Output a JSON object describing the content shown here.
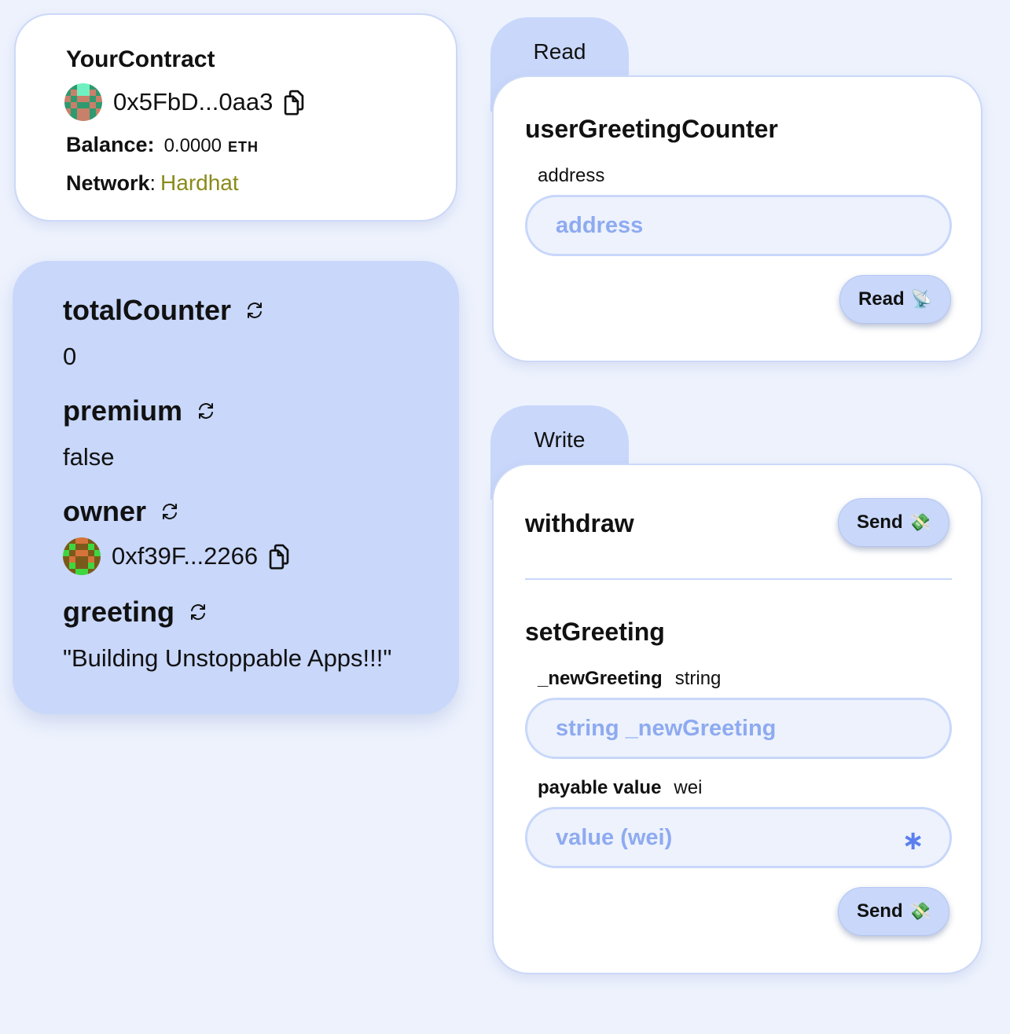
{
  "contract": {
    "name": "YourContract",
    "address": "0x5FbD...0aa3",
    "balance_label": "Balance:",
    "balance_value": "0.0000",
    "balance_unit": "ETH",
    "network_label": "Network",
    "network_sep": ":",
    "network_value": "Hardhat",
    "network_color": "#8a8a1a"
  },
  "variables": [
    {
      "name": "totalCounter",
      "value": "0"
    },
    {
      "name": "premium",
      "value": "false"
    },
    {
      "name": "owner",
      "value": "0xf39F...2266"
    },
    {
      "name": "greeting",
      "value": "\"Building Unstoppable Apps!!!\""
    }
  ],
  "read_tab": {
    "label": "Read",
    "function": {
      "name": "userGreetingCounter",
      "param_label": "address",
      "input_placeholder": "address",
      "button_label": "Read",
      "button_icon": "📡"
    }
  },
  "write_tab": {
    "label": "Write",
    "withdraw": {
      "name": "withdraw",
      "button_label": "Send",
      "button_icon": "💸"
    },
    "setGreeting": {
      "name": "setGreeting",
      "param_name": "_newGreeting",
      "param_type": "string",
      "input_placeholder": "string _newGreeting",
      "value_label": "payable value",
      "value_unit": "wei",
      "value_placeholder": "value (wei)",
      "value_suffix": "∗",
      "button_label": "Send",
      "button_icon": "💸"
    }
  },
  "colors": {
    "page_bg": "#edf2fd",
    "accent": "#c8d7fa",
    "placeholder": "#8eaaf0"
  }
}
